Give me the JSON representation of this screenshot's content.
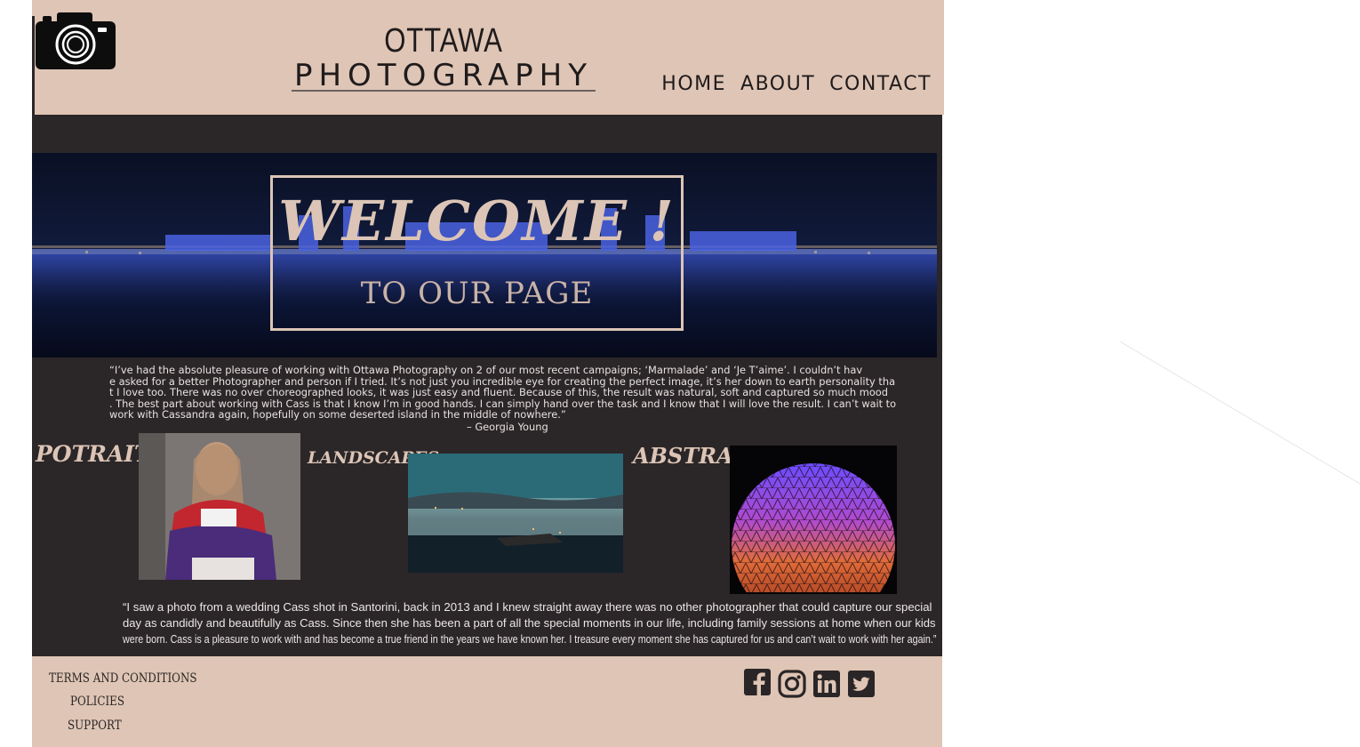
{
  "brand": {
    "city": "OTTAWA",
    "subtitle": "PHOTOGRAPHY"
  },
  "nav": {
    "home": "HOME",
    "about": "ABOUT",
    "contact": "CONTACT"
  },
  "hero": {
    "title": "WELCOME !",
    "subtitle": "TO OUR PAGE"
  },
  "testimonial_1": {
    "lines": [
      "“I’ve had the absolute pleasure of working with Ottawa Photography on 2 of our most recent campaigns; ‘Marmalade’ and ‘Je T’aime’. I couldn’t hav",
      "e asked for a better Photographer and person if I tried. It’s not just you incredible eye for creating the perfect image, it’s her down to earth personality tha",
      "t I love too. There was no over choreographed looks, it was just easy and fluent. Because of this, the result was natural, soft and captured so much mood",
      ". The best part about working with Cass is that I know I’m in good hands. I can simply hand over the task and I know that I will love the result. I can’t wait to",
      "work with Cassandra again, hopefully on some deserted island in the middle of nowhere.”"
    ],
    "author": "– Georgia Young"
  },
  "categories": {
    "portraits": "POTRAITS",
    "landscapes": "LANDSCAPES",
    "abstracts": "ABSTRACTS"
  },
  "testimonial_2": {
    "lines": [
      "“I saw a photo from a wedding Cass shot in Santorini, back in 2013 and I knew straight away there was no other photographer that could capture our special",
      "day as candidly and beautifully as Cass. Since then she has been a part of all the special moments in our life, including family sessions at home when our kids",
      "were born. Cass is a pleasure to work with and has become a true friend in the years we have known her. I treasure every moment she has captured for us and can’t wait to work with her again.”"
    ]
  },
  "footer": {
    "terms": "TERMS AND CONDITIONS",
    "policies": "POLICIES",
    "support": "SUPPORT"
  },
  "social_icons": [
    "facebook-icon",
    "instagram-icon",
    "linkedin-icon",
    "twitter-icon"
  ],
  "colors": {
    "header_bg": "#dfc5b5",
    "main_bg": "#2b2628",
    "accent": "#dcc5b6",
    "text_dark": "#1f1b1c"
  }
}
